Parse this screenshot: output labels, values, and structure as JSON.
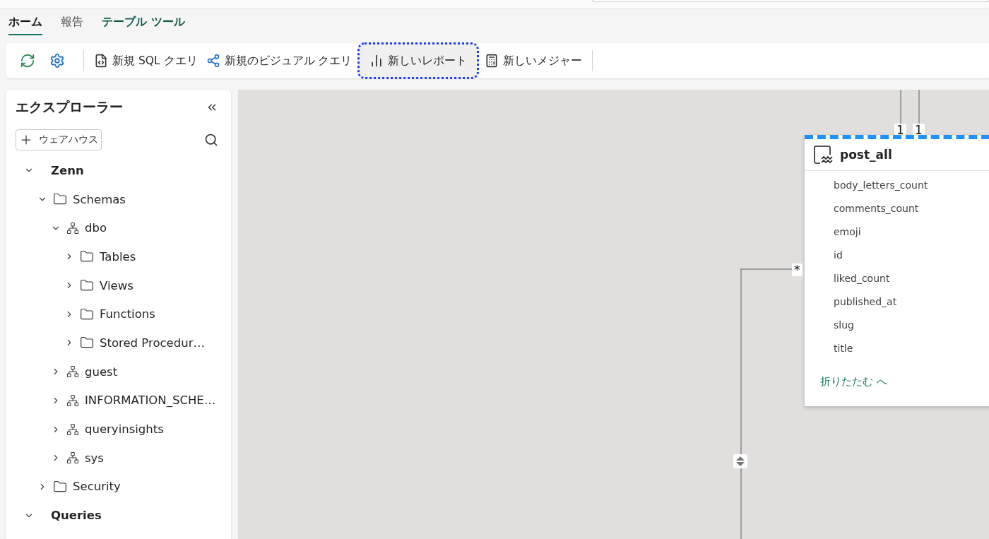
{
  "tabs": [
    {
      "label": "ホーム",
      "selected": true
    },
    {
      "label": "報告",
      "selected": false
    },
    {
      "label": "テーブル ツール",
      "selected": false
    }
  ],
  "toolbar": [
    {
      "kind": "refresh"
    },
    {
      "kind": "settings"
    },
    {
      "kind": "sql",
      "label": "新規 SQL クエリ",
      "highlighted": false
    },
    {
      "kind": "visual",
      "label": "新規のビジュアル クエリ",
      "highlighted": false
    },
    {
      "kind": "report",
      "label": "新しいレポート",
      "highlighted": true
    },
    {
      "kind": "measure",
      "label": "新しいメジャー",
      "highlighted": false
    }
  ],
  "explorer": {
    "title": "エクスプローラー",
    "add_button": "ウェアハウス",
    "tree": [
      {
        "label": "Zenn",
        "kind": "root",
        "expanded": true,
        "children": [
          {
            "label": "Schemas",
            "kind": "folder",
            "expanded": true,
            "children": [
              {
                "label": "dbo",
                "kind": "schema",
                "expanded": true,
                "children": [
                  {
                    "label": "Tables",
                    "kind": "folder",
                    "expanded": false
                  },
                  {
                    "label": "Views",
                    "kind": "folder",
                    "expanded": false
                  },
                  {
                    "label": "Functions",
                    "kind": "folder",
                    "expanded": false
                  },
                  {
                    "label": "Stored Procedur…",
                    "kind": "folder",
                    "expanded": false
                  }
                ]
              },
              {
                "label": "guest",
                "kind": "schema",
                "expanded": false
              },
              {
                "label": "INFORMATION_SCHE…",
                "kind": "schema",
                "expanded": false
              },
              {
                "label": "queryinsights",
                "kind": "schema",
                "expanded": false
              },
              {
                "label": "sys",
                "kind": "schema",
                "expanded": false
              }
            ]
          },
          {
            "label": "Security",
            "kind": "folder",
            "expanded": false
          }
        ]
      },
      {
        "label": "Queries",
        "kind": "root",
        "expanded": true
      }
    ]
  },
  "diagram": {
    "cardinalities": [
      "1",
      "1",
      "*"
    ],
    "table": {
      "name": "post_all",
      "selected": true,
      "columns": [
        "body_letters_count",
        "comments_count",
        "emoji",
        "id",
        "liked_count",
        "published_at",
        "slug",
        "title"
      ],
      "collapse_link": "折りたたむ へ"
    }
  }
}
